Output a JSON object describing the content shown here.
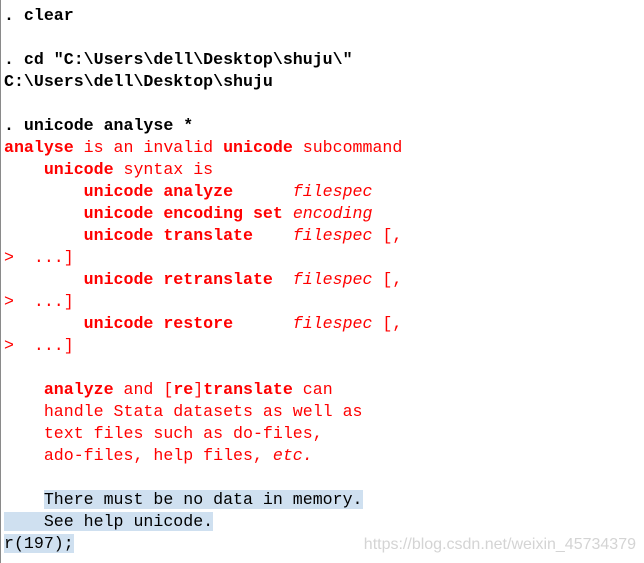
{
  "console": {
    "lines": [
      [
        {
          "t": ". clear",
          "c": "cmd"
        }
      ],
      [],
      [
        {
          "t": ". cd \"C:\\Users\\dell\\Desktop\\shuju\\\"",
          "c": "cmd"
        }
      ],
      [
        {
          "t": "C:\\Users\\dell\\Desktop\\shuju",
          "c": "cmd"
        }
      ],
      [],
      [
        {
          "t": ". unicode analyse *",
          "c": "cmd"
        }
      ],
      [
        {
          "t": "analyse",
          "c": "err b"
        },
        {
          "t": " is an invalid ",
          "c": "err"
        },
        {
          "t": "unicode",
          "c": "err b"
        },
        {
          "t": " subcommand",
          "c": "err"
        }
      ],
      [
        {
          "t": "    ",
          "c": ""
        },
        {
          "t": "unicode",
          "c": "err b"
        },
        {
          "t": " syntax is",
          "c": "err"
        }
      ],
      [
        {
          "t": "        ",
          "c": ""
        },
        {
          "t": "unicode analyze",
          "c": "err b"
        },
        {
          "t": "      ",
          "c": ""
        },
        {
          "t": "filespec",
          "c": "err i"
        }
      ],
      [
        {
          "t": "        ",
          "c": ""
        },
        {
          "t": "unicode encoding set",
          "c": "err b"
        },
        {
          "t": " ",
          "c": ""
        },
        {
          "t": "encoding",
          "c": "err i"
        }
      ],
      [
        {
          "t": "        ",
          "c": ""
        },
        {
          "t": "unicode translate",
          "c": "err b"
        },
        {
          "t": "    ",
          "c": ""
        },
        {
          "t": "filespec",
          "c": "err i"
        },
        {
          "t": " [,",
          "c": "err"
        }
      ],
      [
        {
          "t": ">  ...]",
          "c": "err"
        }
      ],
      [
        {
          "t": "        ",
          "c": ""
        },
        {
          "t": "unicode retranslate",
          "c": "err b"
        },
        {
          "t": "  ",
          "c": ""
        },
        {
          "t": "filespec",
          "c": "err i"
        },
        {
          "t": " [,",
          "c": "err"
        }
      ],
      [
        {
          "t": ">  ...]",
          "c": "err"
        }
      ],
      [
        {
          "t": "        ",
          "c": ""
        },
        {
          "t": "unicode restore",
          "c": "err b"
        },
        {
          "t": "      ",
          "c": ""
        },
        {
          "t": "filespec",
          "c": "err i"
        },
        {
          "t": " [,",
          "c": "err"
        }
      ],
      [
        {
          "t": ">  ...]",
          "c": "err"
        }
      ],
      [],
      [
        {
          "t": "    ",
          "c": ""
        },
        {
          "t": "analyze",
          "c": "err b"
        },
        {
          "t": " and [",
          "c": "err"
        },
        {
          "t": "re",
          "c": "err b"
        },
        {
          "t": "]",
          "c": "err"
        },
        {
          "t": "translate",
          "c": "err b"
        },
        {
          "t": " can",
          "c": "err"
        }
      ],
      [
        {
          "t": "    handle Stata datasets as well as",
          "c": "err"
        }
      ],
      [
        {
          "t": "    text files such as do-files,",
          "c": "err"
        }
      ],
      [
        {
          "t": "    ado-files, help files, ",
          "c": "err"
        },
        {
          "t": "etc.",
          "c": "err i"
        }
      ],
      [],
      [
        {
          "t": "    ",
          "c": ""
        },
        {
          "t": "There must be no data in memory.",
          "c": "sel"
        }
      ],
      [
        {
          "t": "    See help unicode.",
          "c": "sel"
        }
      ],
      [
        {
          "t": "r(197);",
          "c": "sel"
        }
      ]
    ]
  },
  "watermark": "https://blog.csdn.net/weixin_45734379",
  "colors": {
    "error": "#ff0000",
    "selection": "#cfe0f0"
  }
}
